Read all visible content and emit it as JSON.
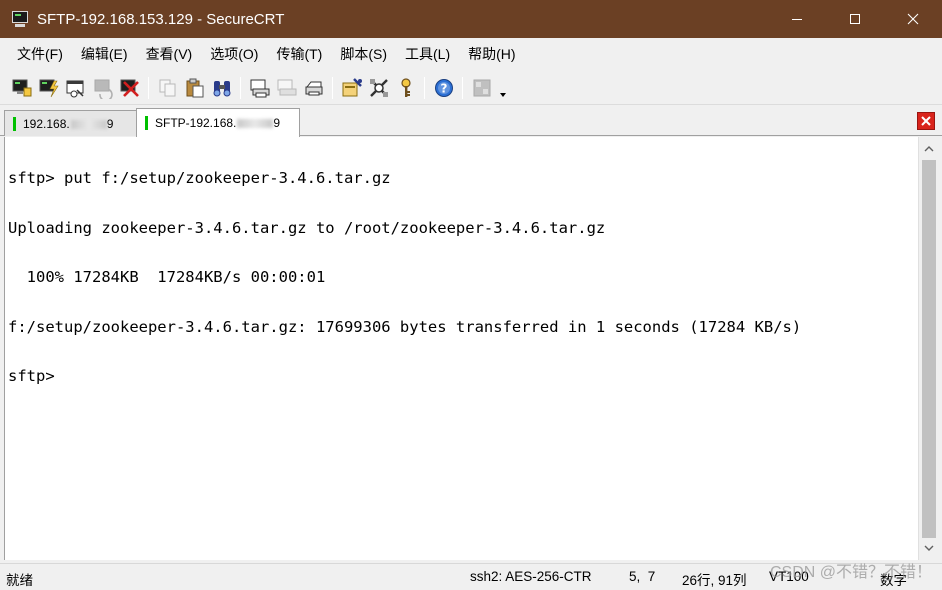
{
  "window": {
    "title": "SFTP-192.168.153.129 - SecureCRT",
    "controls": [
      "minimize-icon",
      "maximize-icon",
      "close-icon"
    ]
  },
  "menu": {
    "items": [
      "文件(F)",
      "编辑(E)",
      "查看(V)",
      "选项(O)",
      "传输(T)",
      "脚本(S)",
      "工具(L)",
      "帮助(H)"
    ]
  },
  "toolbar": {
    "icons": [
      "connect-icon",
      "quick-connect-icon",
      "connect-in-tab-icon",
      "reconnect-icon",
      "disconnect-icon",
      "copy-icon",
      "paste-icon",
      "find-icon",
      "print-icon",
      "print-selection-icon",
      "print-setup-icon",
      "session-options-icon",
      "global-options-icon",
      "keymap-icon",
      "help-icon",
      "sftp-icon"
    ]
  },
  "tabs": [
    {
      "label_prefix": "192.168.",
      "label_suffix": "9",
      "active": false,
      "status_color": "#00c000"
    },
    {
      "label_prefix": "SFTP-192.168.",
      "label_suffix": "9",
      "active": true,
      "status_color": "#00c000"
    }
  ],
  "terminal": {
    "lines": [
      "sftp> put f:/setup/zookeeper-3.4.6.tar.gz",
      "Uploading zookeeper-3.4.6.tar.gz to /root/zookeeper-3.4.6.tar.gz",
      "  100% 17284KB  17284KB/s 00:00:01",
      "f:/setup/zookeeper-3.4.6.tar.gz: 17699306 bytes transferred in 1 seconds (17284 KB/s)",
      "sftp>"
    ]
  },
  "statusbar": {
    "ready": "就绪",
    "cipher": "ssh2: AES-256-CTR",
    "cursor": "5,  7",
    "size": "26行, 91列",
    "emulation": "VT100",
    "numlock": "数字"
  },
  "watermark": "CSDN @不错？不错！",
  "colors": {
    "titlebar": "#6b4024",
    "tab_status": "#00c000",
    "tab_close": "#d9241c"
  }
}
